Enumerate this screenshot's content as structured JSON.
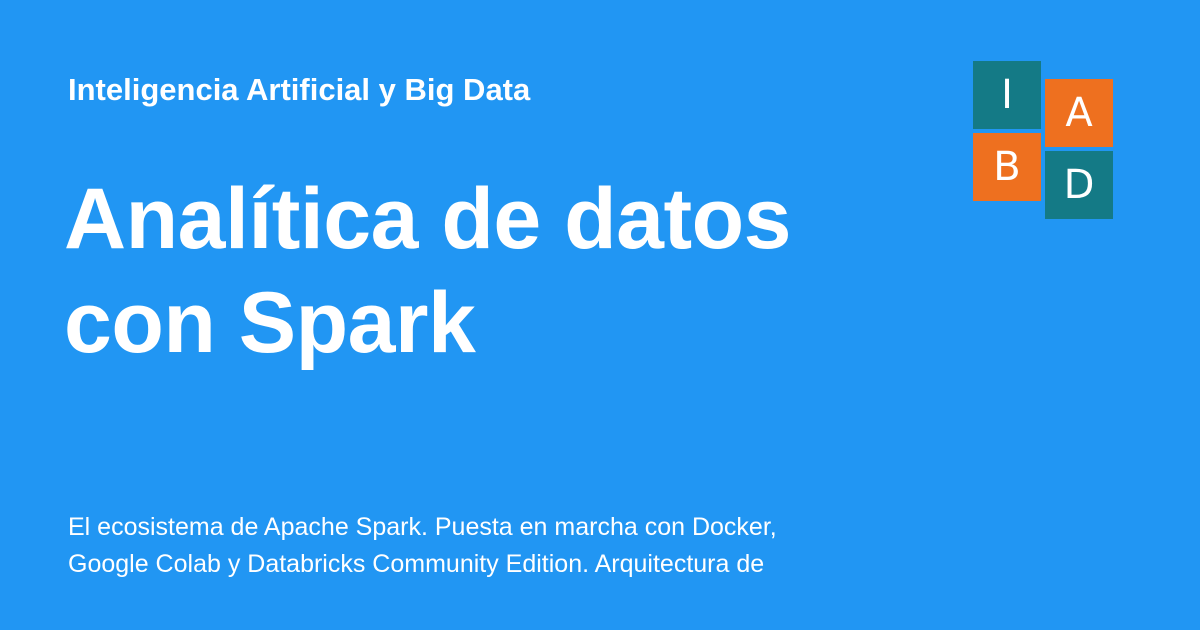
{
  "colors": {
    "background": "#2196f3",
    "text": "#ffffff",
    "logo_teal": "#147a86",
    "logo_orange": "#ee701f"
  },
  "header": {
    "site_name": "Inteligencia Artificial y Big Data"
  },
  "main": {
    "title_lines": [
      "Analítica de datos",
      "con Spark"
    ],
    "description_lines": [
      "El ecosistema de Apache Spark. Puesta en marcha con Docker,",
      "Google Colab y Databricks Community Edition. Arquitectura de"
    ]
  },
  "logo": {
    "tiles": [
      {
        "letter": "I",
        "color": "#147a86"
      },
      {
        "letter": "A",
        "color": "#ee701f"
      },
      {
        "letter": "B",
        "color": "#ee701f"
      },
      {
        "letter": "D",
        "color": "#147a86"
      }
    ]
  }
}
